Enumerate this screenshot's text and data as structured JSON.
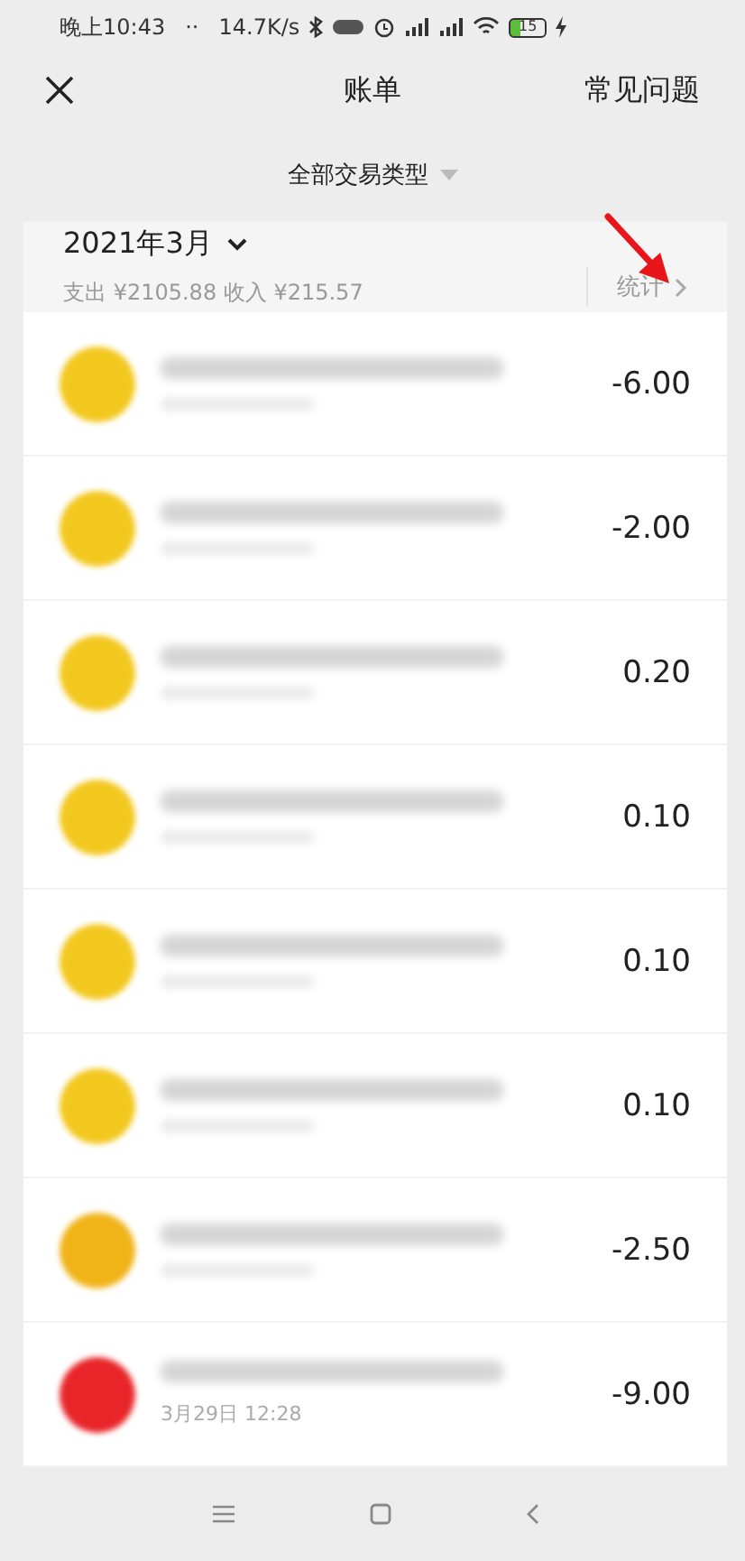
{
  "status_bar": {
    "time": "晚上10:43",
    "dots": "··",
    "speed": "14.7K/s",
    "battery": "15"
  },
  "header": {
    "title": "账单",
    "help": "常见问题"
  },
  "filter": {
    "label": "全部交易类型"
  },
  "month": {
    "title": "2021年3月",
    "summary": "支出 ¥2105.88 收入 ¥215.57",
    "stats": "统计"
  },
  "rows": [
    {
      "amount": "-6.00",
      "color": "#f2c81e"
    },
    {
      "amount": "-2.00",
      "color": "#f2c81e"
    },
    {
      "amount": "0.20",
      "color": "#f2c81e"
    },
    {
      "amount": "0.10",
      "color": "#f2c81e"
    },
    {
      "amount": "0.10",
      "color": "#f2c81e"
    },
    {
      "amount": "0.10",
      "color": "#f2c81e"
    },
    {
      "amount": "-2.50",
      "color": "#f0b419"
    },
    {
      "amount": "-9.00",
      "color": "#e8262a",
      "date": "3月29日 12:28"
    }
  ]
}
